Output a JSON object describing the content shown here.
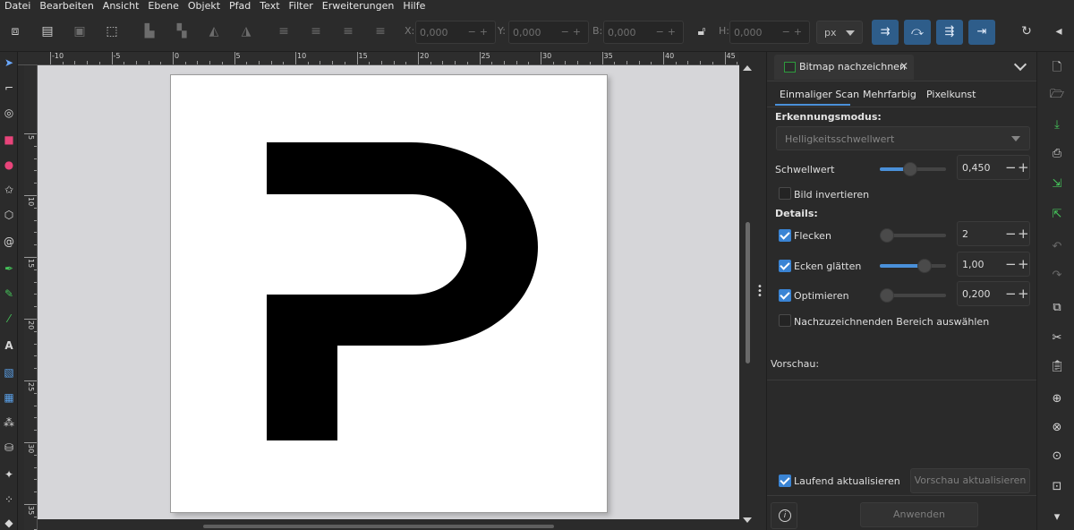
{
  "menu": [
    "Datei",
    "Bearbeiten",
    "Ansicht",
    "Ebene",
    "Objekt",
    "Pfad",
    "Text",
    "Filter",
    "Erweiterungen",
    "Hilfe"
  ],
  "toolbar": {
    "x_label": "X:",
    "x_value": "0,000",
    "y_label": "Y:",
    "y_value": "0,000",
    "b_label": "B:",
    "b_value": "0,000",
    "h_label": "H:",
    "h_value": "0,000",
    "unit": "px"
  },
  "ruler_top": [
    "-10",
    "-5",
    "0",
    "5",
    "10",
    "15",
    "20",
    "25",
    "30",
    "35",
    "40",
    "45"
  ],
  "ruler_left": [
    "5",
    "10",
    "15",
    "20",
    "25",
    "30",
    "35"
  ],
  "panel": {
    "tab_title": "Bitmap nachzeichnen",
    "subtabs": [
      "Einmaliger Scan",
      "Mehrfarbig",
      "Pixelkunst"
    ],
    "mode_label": "Erkennungsmodus:",
    "mode_value": "Helligkeitsschwellwert",
    "threshold_label": "Schwellwert",
    "threshold_value": "0,450",
    "threshold_level": 0.45,
    "invert_label": "Bild invertieren",
    "invert_checked": false,
    "details_label": "Details:",
    "speckles_label": "Flecken",
    "speckles_value": "2",
    "speckles_checked": true,
    "speckles_level": 0.0,
    "corners_label": "Ecken glätten",
    "corners_value": "1,00",
    "corners_checked": true,
    "corners_level": 0.73,
    "optimize_label": "Optimieren",
    "optimize_value": "0,200",
    "optimize_checked": true,
    "optimize_level": 0.0,
    "select_area_label": "Nachzuzeichnenden Bereich auswählen",
    "select_area_checked": false,
    "preview_label": "Vorschau:",
    "live_update_label": "Laufend aktualisieren",
    "live_update_checked": true,
    "update_preview_button": "Vorschau aktualisieren",
    "apply_button": "Anwenden"
  },
  "colors": {
    "accent": "#4a90d9",
    "snap_active": "#2e5d8a",
    "canvas_bg": "#d6d6d9",
    "glyph": "#000000"
  }
}
